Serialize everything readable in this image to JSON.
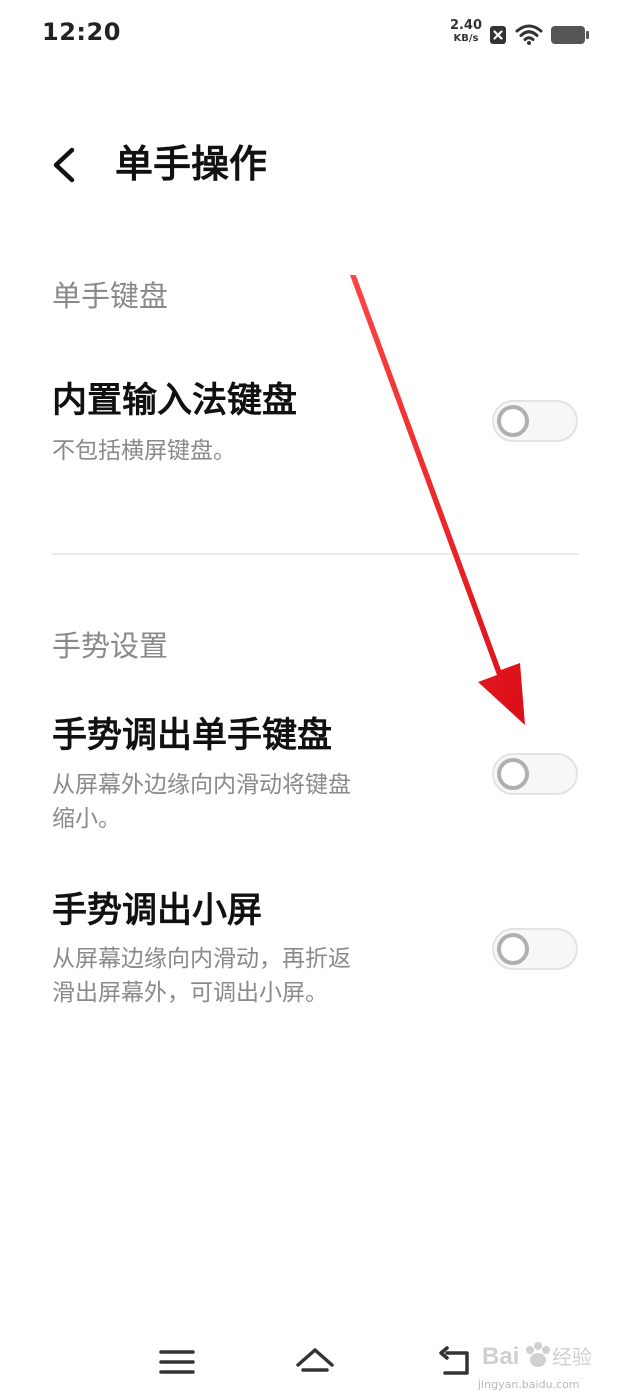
{
  "status_bar": {
    "time": "12:20",
    "net_speed_value": "2.40",
    "net_speed_unit": "KB/s",
    "icons": [
      "sim-x-icon",
      "wifi-icon",
      "battery-icon"
    ]
  },
  "header": {
    "back_icon": "chevron-left-icon",
    "title": "单手操作"
  },
  "sections": [
    {
      "header": "单手键盘",
      "items": [
        {
          "title": "内置输入法键盘",
          "description": "不包括横屏键盘。",
          "toggle_on": false
        }
      ]
    },
    {
      "header": "手势设置",
      "items": [
        {
          "title": "手势调出单手键盘",
          "description_line1": "从屏幕外边缘向内滑动将键盘",
          "description_line2": "缩小。",
          "toggle_on": false
        },
        {
          "title": "手势调出小屏",
          "description_line1": "从屏幕边缘向内滑动，再折返",
          "description_line2": "滑出屏幕外，可调出小屏。",
          "toggle_on": false
        }
      ]
    }
  ],
  "nav_bar": {
    "icons": [
      "menu-icon",
      "home-icon",
      "back-icon"
    ]
  },
  "watermark": {
    "logo_text": "Bai经验",
    "url": "jingyan.baidu.com"
  },
  "colors": {
    "annotation_arrow": "#e8141b",
    "section_header": "#8a8a8a",
    "toggle_off": "#b0b0b0"
  }
}
